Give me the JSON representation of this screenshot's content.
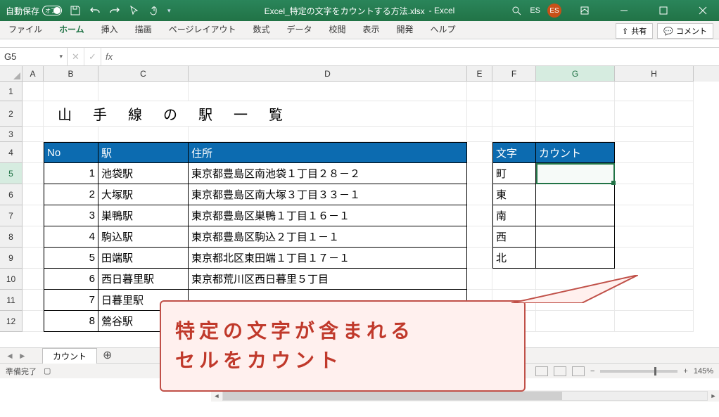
{
  "title_bar": {
    "autosave_label": "自動保存",
    "autosave_state": "オフ",
    "filename": "Excel_特定の文字をカウントする方法.xlsx",
    "app_suffix": " - Excel",
    "user_initials_text": "ES",
    "user_badge_text": "ES"
  },
  "ribbon": {
    "tabs": [
      "ファイル",
      "ホーム",
      "挿入",
      "描画",
      "ページレイアウト",
      "数式",
      "データ",
      "校閲",
      "表示",
      "開発",
      "ヘルプ"
    ],
    "share_label": "共有",
    "comments_label": "コメント"
  },
  "formula_bar": {
    "name_box": "G5",
    "fx_label": "fx",
    "formula": ""
  },
  "columns": [
    "A",
    "B",
    "C",
    "D",
    "E",
    "F",
    "G",
    "H"
  ],
  "rows": [
    "1",
    "2",
    "3",
    "4",
    "5",
    "6",
    "7",
    "8",
    "9",
    "10",
    "11",
    "12"
  ],
  "active_cell": "G5",
  "sheet": {
    "title_b2": "山手線の駅一覧",
    "headers": {
      "no": "No",
      "station": "駅",
      "address": "住所",
      "char": "文字",
      "count": "カウント"
    },
    "data": [
      {
        "no": "1",
        "station": "池袋駅",
        "address": "東京都豊島区南池袋１丁目２８－２"
      },
      {
        "no": "2",
        "station": "大塚駅",
        "address": "東京都豊島区南大塚３丁目３３－１"
      },
      {
        "no": "3",
        "station": "巣鴨駅",
        "address": "東京都豊島区巣鴨１丁目１６－１"
      },
      {
        "no": "4",
        "station": "駒込駅",
        "address": "東京都豊島区駒込２丁目１－１"
      },
      {
        "no": "5",
        "station": "田端駅",
        "address": "東京都北区東田端１丁目１７－１"
      },
      {
        "no": "6",
        "station": "西日暮里駅",
        "address": "東京都荒川区西日暮里５丁目"
      },
      {
        "no": "7",
        "station": "日暮里駅",
        "address": ""
      },
      {
        "no": "8",
        "station": "鶯谷駅",
        "address": ""
      }
    ],
    "chars": [
      "町",
      "東",
      "南",
      "西",
      "北"
    ]
  },
  "tabs": {
    "active": "カウント"
  },
  "callout": {
    "line1": "特定の文字が含まれる",
    "line2": "セルをカウント"
  },
  "status": {
    "ready": "準備完了",
    "zoom": "145%"
  }
}
